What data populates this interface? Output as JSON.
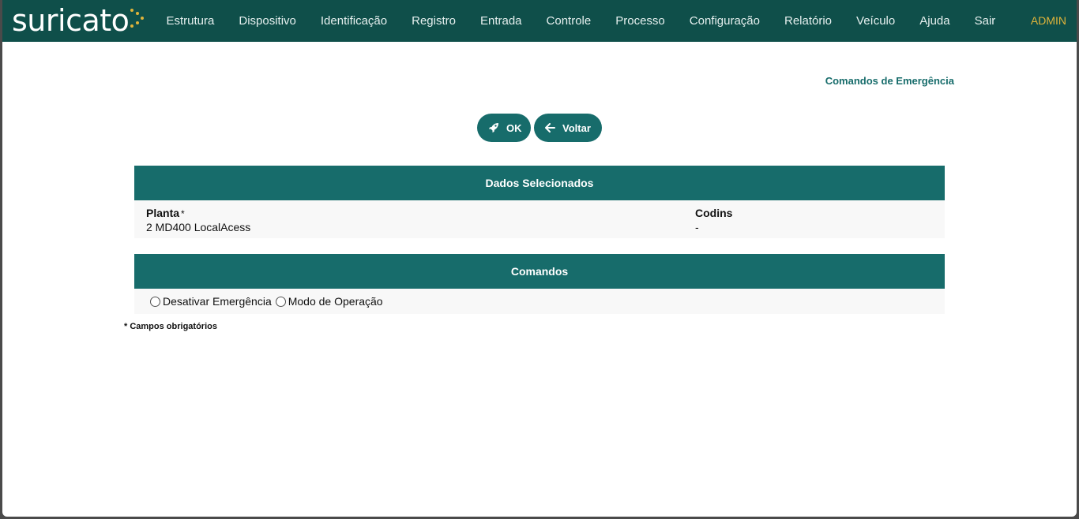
{
  "app": {
    "logo_text": "suricato",
    "brand_color": "#0f4f4a",
    "accent_color": "#176c6b",
    "user_color": "#e0b43a"
  },
  "nav": {
    "items": [
      "Estrutura",
      "Dispositivo",
      "Identificação",
      "Registro",
      "Entrada",
      "Controle",
      "Processo",
      "Configuração",
      "Relatório",
      "Veículo",
      "Ajuda",
      "Sair"
    ],
    "user": "ADMIN"
  },
  "page": {
    "title": "Comandos de Emergência"
  },
  "actions": {
    "ok_label": "OK",
    "ok_icon": "rocket-icon",
    "back_label": "Voltar",
    "back_icon": "arrow-left-icon"
  },
  "selected": {
    "header": "Dados Selecionados",
    "planta_label": "Planta",
    "planta_required": "*",
    "planta_value": "2 MD400 LocalAcess",
    "codins_label": "Codins",
    "codins_value": "-"
  },
  "commands": {
    "header": "Comandos",
    "options": [
      "Desativar Emergência",
      "Modo de Operação"
    ]
  },
  "footnote": "* Campos obrigatórios"
}
